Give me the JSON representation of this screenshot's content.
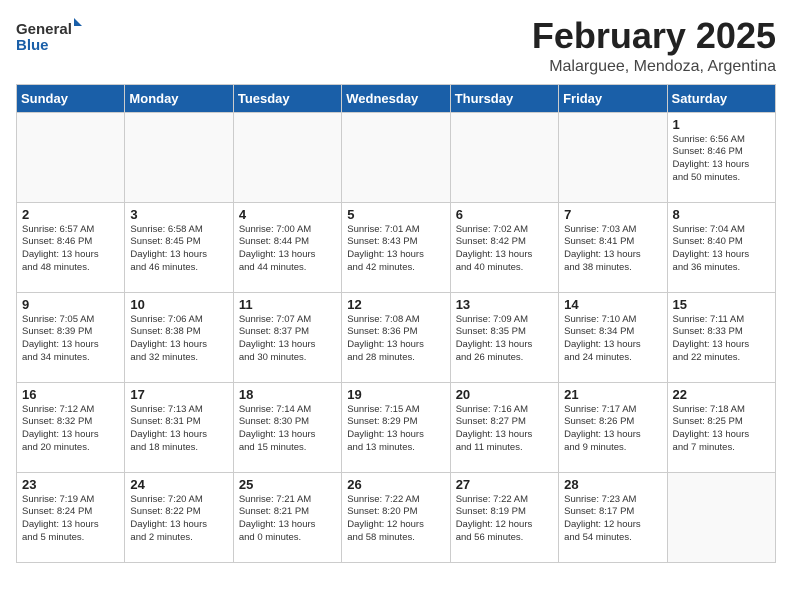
{
  "header": {
    "logo_general": "General",
    "logo_blue": "Blue",
    "month_year": "February 2025",
    "location": "Malarguee, Mendoza, Argentina"
  },
  "days_of_week": [
    "Sunday",
    "Monday",
    "Tuesday",
    "Wednesday",
    "Thursday",
    "Friday",
    "Saturday"
  ],
  "weeks": [
    [
      {
        "day": "",
        "info": ""
      },
      {
        "day": "",
        "info": ""
      },
      {
        "day": "",
        "info": ""
      },
      {
        "day": "",
        "info": ""
      },
      {
        "day": "",
        "info": ""
      },
      {
        "day": "",
        "info": ""
      },
      {
        "day": "1",
        "info": "Sunrise: 6:56 AM\nSunset: 8:46 PM\nDaylight: 13 hours\nand 50 minutes."
      }
    ],
    [
      {
        "day": "2",
        "info": "Sunrise: 6:57 AM\nSunset: 8:46 PM\nDaylight: 13 hours\nand 48 minutes."
      },
      {
        "day": "3",
        "info": "Sunrise: 6:58 AM\nSunset: 8:45 PM\nDaylight: 13 hours\nand 46 minutes."
      },
      {
        "day": "4",
        "info": "Sunrise: 7:00 AM\nSunset: 8:44 PM\nDaylight: 13 hours\nand 44 minutes."
      },
      {
        "day": "5",
        "info": "Sunrise: 7:01 AM\nSunset: 8:43 PM\nDaylight: 13 hours\nand 42 minutes."
      },
      {
        "day": "6",
        "info": "Sunrise: 7:02 AM\nSunset: 8:42 PM\nDaylight: 13 hours\nand 40 minutes."
      },
      {
        "day": "7",
        "info": "Sunrise: 7:03 AM\nSunset: 8:41 PM\nDaylight: 13 hours\nand 38 minutes."
      },
      {
        "day": "8",
        "info": "Sunrise: 7:04 AM\nSunset: 8:40 PM\nDaylight: 13 hours\nand 36 minutes."
      }
    ],
    [
      {
        "day": "9",
        "info": "Sunrise: 7:05 AM\nSunset: 8:39 PM\nDaylight: 13 hours\nand 34 minutes."
      },
      {
        "day": "10",
        "info": "Sunrise: 7:06 AM\nSunset: 8:38 PM\nDaylight: 13 hours\nand 32 minutes."
      },
      {
        "day": "11",
        "info": "Sunrise: 7:07 AM\nSunset: 8:37 PM\nDaylight: 13 hours\nand 30 minutes."
      },
      {
        "day": "12",
        "info": "Sunrise: 7:08 AM\nSunset: 8:36 PM\nDaylight: 13 hours\nand 28 minutes."
      },
      {
        "day": "13",
        "info": "Sunrise: 7:09 AM\nSunset: 8:35 PM\nDaylight: 13 hours\nand 26 minutes."
      },
      {
        "day": "14",
        "info": "Sunrise: 7:10 AM\nSunset: 8:34 PM\nDaylight: 13 hours\nand 24 minutes."
      },
      {
        "day": "15",
        "info": "Sunrise: 7:11 AM\nSunset: 8:33 PM\nDaylight: 13 hours\nand 22 minutes."
      }
    ],
    [
      {
        "day": "16",
        "info": "Sunrise: 7:12 AM\nSunset: 8:32 PM\nDaylight: 13 hours\nand 20 minutes."
      },
      {
        "day": "17",
        "info": "Sunrise: 7:13 AM\nSunset: 8:31 PM\nDaylight: 13 hours\nand 18 minutes."
      },
      {
        "day": "18",
        "info": "Sunrise: 7:14 AM\nSunset: 8:30 PM\nDaylight: 13 hours\nand 15 minutes."
      },
      {
        "day": "19",
        "info": "Sunrise: 7:15 AM\nSunset: 8:29 PM\nDaylight: 13 hours\nand 13 minutes."
      },
      {
        "day": "20",
        "info": "Sunrise: 7:16 AM\nSunset: 8:27 PM\nDaylight: 13 hours\nand 11 minutes."
      },
      {
        "day": "21",
        "info": "Sunrise: 7:17 AM\nSunset: 8:26 PM\nDaylight: 13 hours\nand 9 minutes."
      },
      {
        "day": "22",
        "info": "Sunrise: 7:18 AM\nSunset: 8:25 PM\nDaylight: 13 hours\nand 7 minutes."
      }
    ],
    [
      {
        "day": "23",
        "info": "Sunrise: 7:19 AM\nSunset: 8:24 PM\nDaylight: 13 hours\nand 5 minutes."
      },
      {
        "day": "24",
        "info": "Sunrise: 7:20 AM\nSunset: 8:22 PM\nDaylight: 13 hours\nand 2 minutes."
      },
      {
        "day": "25",
        "info": "Sunrise: 7:21 AM\nSunset: 8:21 PM\nDaylight: 13 hours\nand 0 minutes."
      },
      {
        "day": "26",
        "info": "Sunrise: 7:22 AM\nSunset: 8:20 PM\nDaylight: 12 hours\nand 58 minutes."
      },
      {
        "day": "27",
        "info": "Sunrise: 7:22 AM\nSunset: 8:19 PM\nDaylight: 12 hours\nand 56 minutes."
      },
      {
        "day": "28",
        "info": "Sunrise: 7:23 AM\nSunset: 8:17 PM\nDaylight: 12 hours\nand 54 minutes."
      },
      {
        "day": "",
        "info": ""
      }
    ]
  ]
}
